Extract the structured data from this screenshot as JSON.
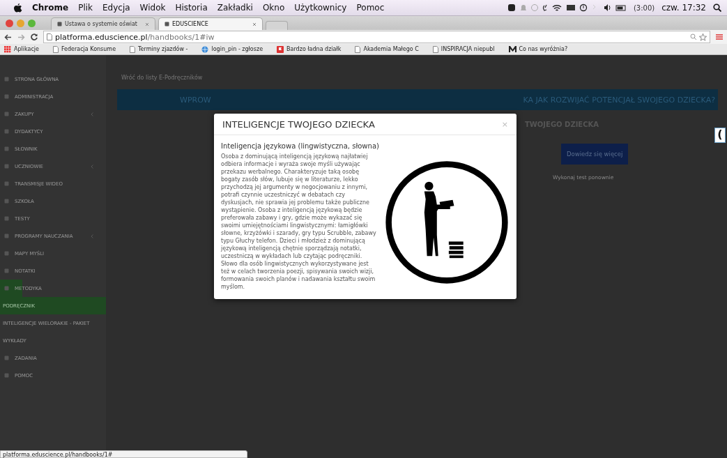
{
  "menu_bar": {
    "app": "Chrome",
    "items": [
      "Plik",
      "Edycja",
      "Widok",
      "Historia",
      "Zakładki",
      "Okno",
      "Użytkownicy",
      "Pomoc"
    ],
    "battery": "(3:00)",
    "clock": "czw. 17:32"
  },
  "tabs": [
    {
      "label": "Ustawa o systemie oświat",
      "selected": false
    },
    {
      "label": "EDUSCIENCE",
      "selected": true
    }
  ],
  "address_bar": {
    "host": "platforma.eduscience.pl",
    "path": "/handbooks/1#iw"
  },
  "bookmarks": [
    {
      "label": "Aplikacje",
      "kind": "apps"
    },
    {
      "label": "Federacja Konsume",
      "kind": "page"
    },
    {
      "label": "Terminy zjazdów -",
      "kind": "page"
    },
    {
      "label": "login_pin - zgłosze",
      "kind": "globe"
    },
    {
      "label": "Bardzo ładna działk",
      "kind": "flag"
    },
    {
      "label": "Akademia Małego C",
      "kind": "page"
    },
    {
      "label": "INSPIRACJA niepubl",
      "kind": "page"
    },
    {
      "label": "Co nas wyróżnia?",
      "kind": "logo"
    }
  ],
  "sidebar": {
    "items": [
      {
        "label": "STRONA GŁÓWNA",
        "kind": "item",
        "selected": false,
        "expandable": false
      },
      {
        "label": "ADMINISTRACJA",
        "kind": "item",
        "selected": false,
        "expandable": false
      },
      {
        "label": "ZAKUPY",
        "kind": "item",
        "selected": false,
        "expandable": true
      },
      {
        "label": "DYDAKTYCY",
        "kind": "item",
        "selected": false,
        "expandable": false
      },
      {
        "label": "SŁOWNIK",
        "kind": "item",
        "selected": false,
        "expandable": false
      },
      {
        "label": "UCZNIOWIE",
        "kind": "item",
        "selected": false,
        "expandable": true
      },
      {
        "label": "TRANSMISJE WIDEO",
        "kind": "item",
        "selected": false,
        "expandable": false
      },
      {
        "label": "SZKOŁA",
        "kind": "item",
        "selected": false,
        "expandable": false
      },
      {
        "label": "TESTY",
        "kind": "item",
        "selected": false,
        "expandable": false
      },
      {
        "label": "PROGRAMY NAUCZANIA",
        "kind": "item",
        "selected": false,
        "expandable": true
      },
      {
        "label": "MAPY MYŚLI",
        "kind": "item",
        "selected": false,
        "expandable": false
      },
      {
        "label": "NOTATKI",
        "kind": "item",
        "selected": false,
        "expandable": false
      },
      {
        "label": "METODYKA",
        "kind": "item",
        "selected": true,
        "expandable": false
      },
      {
        "label": "PODRĘCZNIK",
        "kind": "sub",
        "selected": true
      },
      {
        "label": "INTELIGENCJE WIELORAKIE - PAKIET",
        "kind": "sub",
        "selected": false
      },
      {
        "label": "WYKŁADY",
        "kind": "sub",
        "selected": false
      },
      {
        "label": "ZADANIA",
        "kind": "item",
        "selected": false,
        "expandable": false
      },
      {
        "label": "POMOC",
        "kind": "item",
        "selected": false,
        "expandable": false
      }
    ]
  },
  "content": {
    "breadcrumb": "Wróć do listy E-Podręczników",
    "banner_left": "WPROW",
    "banner_right": "KA JAK ROZWIJAĆ POTENCJAŁ SWOJEGO DZIECKA?",
    "heading": "TWOJEGO DZIECKA",
    "button": "Dowiedz się więcej",
    "link": "Wykonaj test ponownie",
    "edge_mark": "("
  },
  "modal": {
    "title": "INTELIGENCJE TWOJEGO DZIECKA",
    "close": "×",
    "heading": "Inteligencja językowa (lingwistyczna, słowna)",
    "text": "Osoba z dominującą inteligencją językową najłatwiej odbiera informacje i wyraża swoje myśli używając przekazu werbalnego. Charakteryzuje taką osobę bogaty zasób słów, lubuje się w literaturze, lekko przychodzą jej argumenty w negocjowaniu z innymi, potrafi czynnie uczestniczyć w debatach czy dyskusjach, nie sprawia jej problemu także publiczne wystąpienie. Osoba z inteligencją językową będzie preferowała zabawy i gry, gdzie może wykazać się swoimi umiejętnościami lingwistycznymi: łamigłówki słowne, krzyżówki i szarady, gry typu Scrubble, zabawy typu Głuchy telefon. Dzieci i młodzież z dominującą językową inteligencją chętnie sporządzają notatki, uczestniczą w wykładach lub czytając podręczniki. Słowo dla osób lingwistycznych wykorzystywane jest też w celach tworzenia poezji, spisywania swoich wizji, formowania swoich planów i nadawania kształtu swoim myślom."
  },
  "status_bar": "platforma.eduscience.pl/handbooks/1#"
}
